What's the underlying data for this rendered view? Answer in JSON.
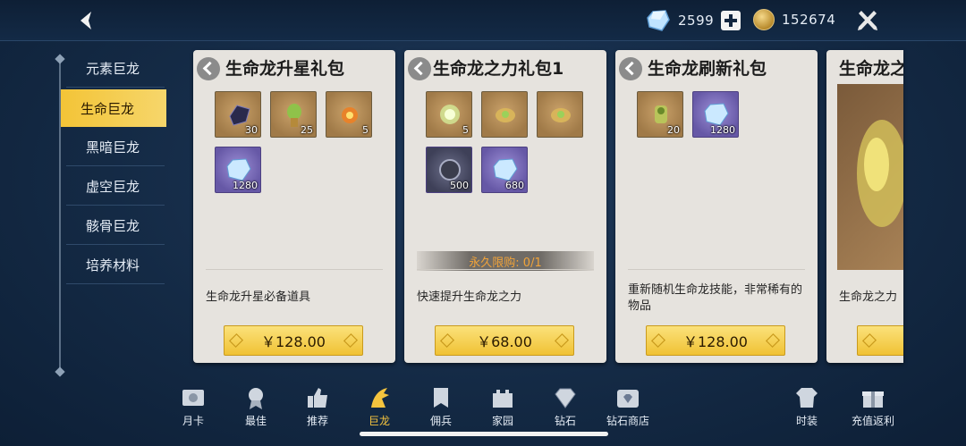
{
  "topbar": {
    "diamond_count": "2599",
    "gold_count": "152674"
  },
  "sidebar": {
    "items": [
      {
        "label": "元素巨龙"
      },
      {
        "label": "生命巨龙"
      },
      {
        "label": "黑暗巨龙"
      },
      {
        "label": "虚空巨龙"
      },
      {
        "label": "骸骨巨龙"
      },
      {
        "label": "培养材料"
      }
    ],
    "active_index": 1
  },
  "cards": [
    {
      "title": "生命龙升星礼包",
      "items": [
        {
          "icon": "dark-crystal-icon",
          "qty": "30"
        },
        {
          "icon": "green-dragon-totem-icon",
          "qty": "25"
        },
        {
          "icon": "fire-orb-icon",
          "qty": "5"
        },
        {
          "icon": "diamond-icon",
          "qty": "1280"
        }
      ],
      "limit": "",
      "description": "生命龙升星必备道具",
      "price": "￥128.00"
    },
    {
      "title": "生命龙之力礼包1",
      "items": [
        {
          "icon": "glowing-green-orb-icon",
          "qty": "5"
        },
        {
          "icon": "golden-dragon-relic-icon",
          "qty": ""
        },
        {
          "icon": "golden-dragon-relic-icon",
          "qty": ""
        },
        {
          "icon": "dark-stone-icon",
          "qty": "500"
        },
        {
          "icon": "diamond-icon",
          "qty": "680"
        }
      ],
      "limit": "永久限购: 0/1",
      "description": "快速提升生命龙之力",
      "price": "￥68.00"
    },
    {
      "title": "生命龙刷新礼包",
      "items": [
        {
          "icon": "green-dragon-statue-icon",
          "qty": "20"
        },
        {
          "icon": "diamond-icon",
          "qty": "1280"
        }
      ],
      "limit": "",
      "description": "重新随机生命龙技能，非常稀有的物品",
      "price": "￥128.00"
    },
    {
      "title": "生命龙之",
      "items": [],
      "limit": "",
      "description": "生命龙之力",
      "price": ""
    }
  ],
  "bottom_nav": [
    {
      "label": "月卡",
      "icon": "month-card-icon"
    },
    {
      "label": "最佳",
      "icon": "medal-icon"
    },
    {
      "label": "推荐",
      "icon": "thumbs-up-icon"
    },
    {
      "label": "巨龙",
      "icon": "dragon-icon"
    },
    {
      "label": "佣兵",
      "icon": "mercenary-banner-icon"
    },
    {
      "label": "家园",
      "icon": "castle-icon"
    },
    {
      "label": "钻石",
      "icon": "diamond-icon"
    },
    {
      "label": "钻石商店",
      "icon": "diamond-shop-icon"
    },
    {
      "label": "时装",
      "icon": "costume-icon"
    },
    {
      "label": "充值返利",
      "icon": "gift-box-icon"
    }
  ],
  "bottom_nav_active_index": 3
}
